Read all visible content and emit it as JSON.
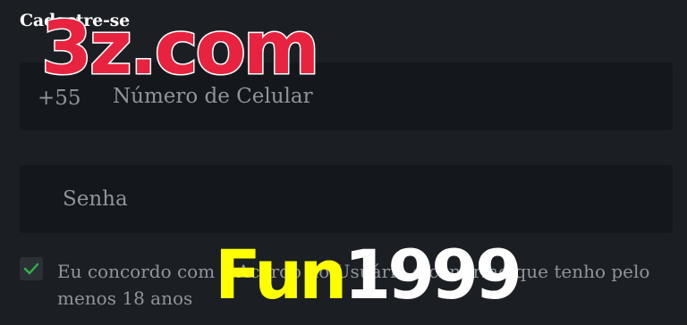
{
  "form": {
    "title": "Cadastre-se",
    "phone": {
      "prefix": "+55",
      "placeholder": "Número de Celular"
    },
    "password": {
      "placeholder": "Senha"
    },
    "terms": {
      "checked": true,
      "text_before": "Eu concordo com o ",
      "link_text": "Acordo do Usuário",
      "text_after": " e confirmo que tenho pelo menos 18 anos"
    }
  },
  "watermarks": {
    "top": "3z.com",
    "bottom_yellow": "Fun",
    "bottom_white": "1999"
  },
  "colors": {
    "background": "#1b1f24",
    "field_background": "#14171b",
    "checkmark": "#2fb344",
    "watermark_red": "#e8233f",
    "watermark_yellow": "#ffff00"
  }
}
